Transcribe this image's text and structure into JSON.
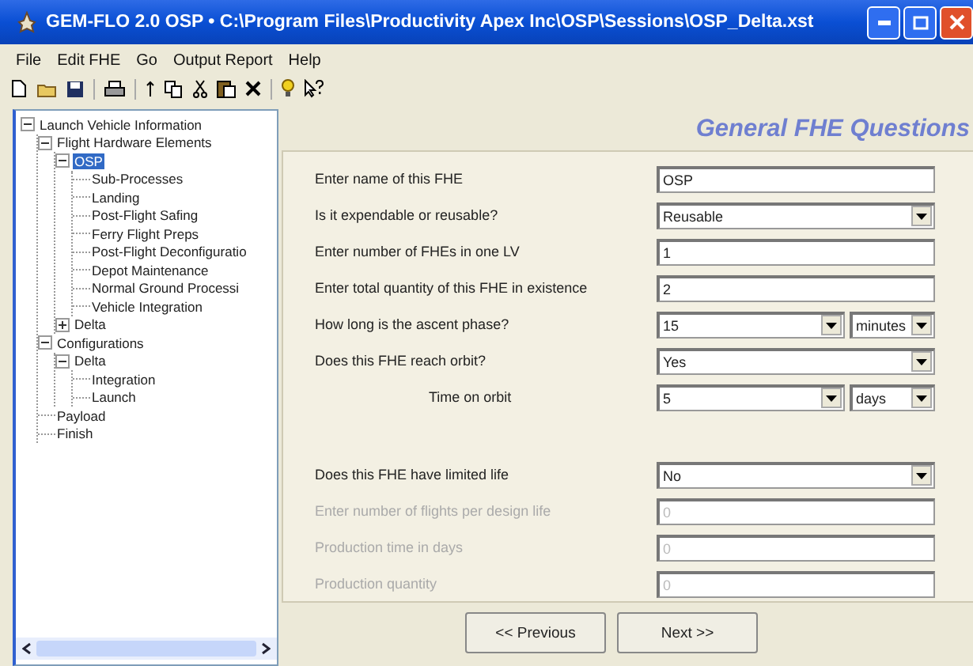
{
  "window": {
    "title": "GEM-FLO 2.0 OSP  •  C:\\Program Files\\Productivity Apex Inc\\OSP\\Sessions\\OSP_Delta.xst"
  },
  "menu": [
    "File",
    "Edit FHE",
    "Go",
    "Output Report",
    "Help"
  ],
  "tree": [
    {
      "label": "Launch Vehicle Information",
      "expanded": true,
      "selected": false,
      "children": [
        {
          "label": "Flight Hardware Elements",
          "expanded": true,
          "selected": false,
          "children": [
            {
              "label": "OSP",
              "expanded": true,
              "selected": true,
              "children": [
                {
                  "label": "Sub-Processes",
                  "selected": false
                },
                {
                  "label": "Landing",
                  "selected": false
                },
                {
                  "label": "Post-Flight Safing",
                  "selected": false
                },
                {
                  "label": "Ferry Flight Preps",
                  "selected": false
                },
                {
                  "label": "Post-Flight Deconfiguratio",
                  "selected": false
                },
                {
                  "label": "Depot Maintenance",
                  "selected": false
                },
                {
                  "label": "Normal Ground Processi",
                  "selected": false
                },
                {
                  "label": "Vehicle Integration",
                  "selected": false
                }
              ]
            },
            {
              "label": "Delta",
              "expanded": false,
              "selected": false
            }
          ]
        },
        {
          "label": "Configurations",
          "expanded": true,
          "selected": false,
          "children": [
            {
              "label": "Delta",
              "expanded": true,
              "selected": false,
              "children": [
                {
                  "label": "Integration",
                  "selected": false
                },
                {
                  "label": "Launch",
                  "selected": false
                }
              ]
            }
          ]
        },
        {
          "label": "Payload",
          "selected": false
        },
        {
          "label": "Finish",
          "selected": false
        }
      ]
    }
  ],
  "heading": "General FHE Questions",
  "sections": [
    [
      {
        "kind": "text",
        "label": "Enter name of this FHE",
        "value": "OSP",
        "disabled": false
      },
      {
        "kind": "combo",
        "label": "Is it expendable or reusable?",
        "value": "Reusable",
        "disabled": false
      },
      {
        "kind": "text",
        "label": "Enter number of FHEs in one LV",
        "value": "1",
        "disabled": false
      },
      {
        "kind": "text",
        "label": "Enter total quantity of this FHE in existence",
        "value": "2",
        "disabled": false
      },
      {
        "kind": "combo-unit",
        "label": "How long is the ascent phase?",
        "value": "15",
        "unit": "minutes",
        "disabled": false
      },
      {
        "kind": "combo",
        "label": "Does this FHE reach orbit?",
        "value": "Yes",
        "disabled": false
      },
      {
        "kind": "sub-combo-unit",
        "label": "Time on orbit",
        "value": "5",
        "unit": "days",
        "disabled": false
      }
    ],
    [
      {
        "kind": "combo",
        "label": "Does this FHE have limited life",
        "value": "No",
        "disabled": false
      },
      {
        "kind": "text",
        "label": "Enter number of flights per design life",
        "value": "0",
        "disabled": true
      },
      {
        "kind": "text",
        "label": "Production time in days",
        "value": "0",
        "disabled": true
      },
      {
        "kind": "text",
        "label": "Production quantity",
        "value": "0",
        "disabled": true
      }
    ]
  ],
  "buttons": [
    "<< Previous",
    "Next >>"
  ]
}
